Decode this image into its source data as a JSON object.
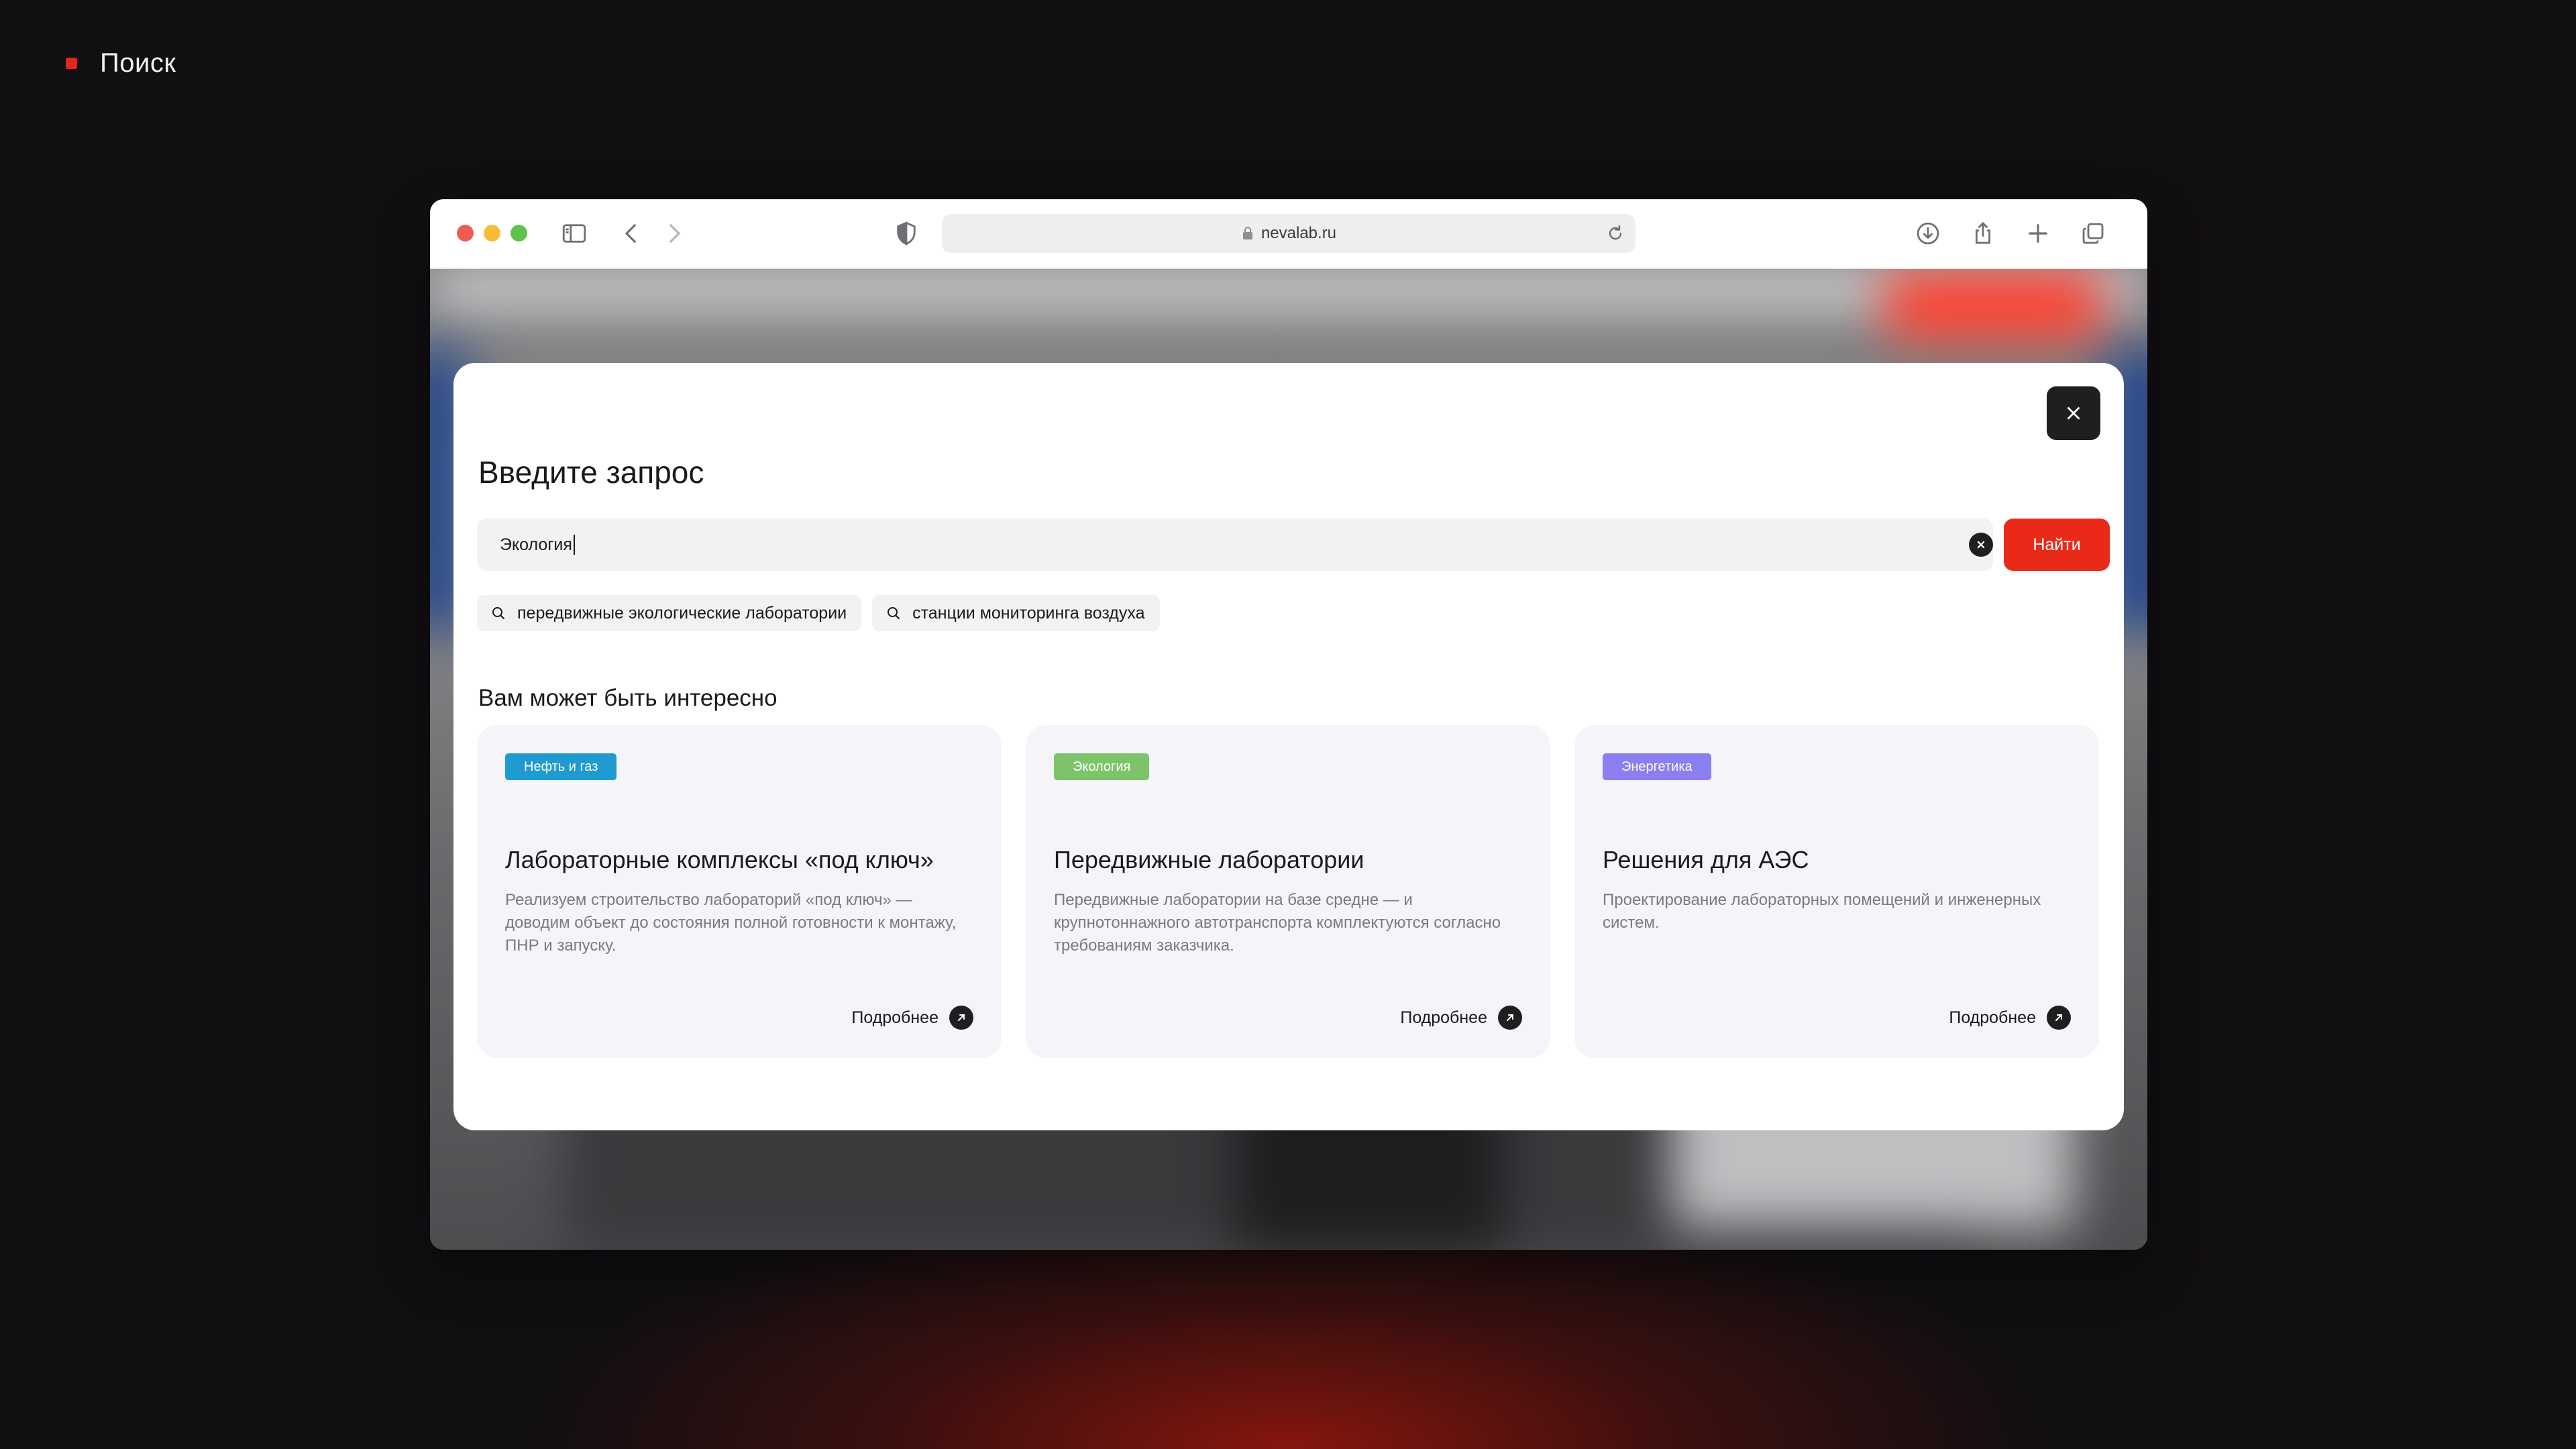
{
  "section": {
    "label": "Поиск"
  },
  "browser": {
    "url": "nevalab.ru",
    "icons": [
      "sidebar-icon",
      "back-icon",
      "forward-icon",
      "shield-icon",
      "lock-icon",
      "reload-icon",
      "download-icon",
      "share-icon",
      "new-tab-icon",
      "tabs-overview-icon"
    ]
  },
  "modal": {
    "title": "Введите запрос",
    "search_value": "Экология",
    "find_label": "Найти",
    "suggestions": [
      {
        "label": "передвижные экологические лаборатории"
      },
      {
        "label": "станции мониторинга воздуха"
      }
    ],
    "recommend_title": "Вам может быть интересно",
    "cards": [
      {
        "tag": "Нефть и газ",
        "tag_color": "#1f9bd1",
        "title": "Лабораторные комплексы «под ключ»",
        "desc": "Реализуем строительство лабораторий «под ключ» — доводим объект до состояния полной готовности к монтажу, ПНР и запуску.",
        "more": "Подробнее"
      },
      {
        "tag": "Экология",
        "tag_color": "#7cc36a",
        "title": "Передвижные лаборатории",
        "desc": "Передвижные лаборатории на базе средне — и крупнотоннажного автотранспорта комплектуются согласно требованиям заказчика.",
        "more": "Подробнее"
      },
      {
        "tag": "Энергетика",
        "tag_color": "#8a7ff0",
        "title": "Решения для АЭС",
        "desc": "Проектирование лабораторных помещений и инженерных систем.",
        "more": "Подробнее"
      }
    ]
  },
  "colors": {
    "accent": "#ea2a18",
    "dark": "#1f1f22",
    "background": "#120f12"
  }
}
